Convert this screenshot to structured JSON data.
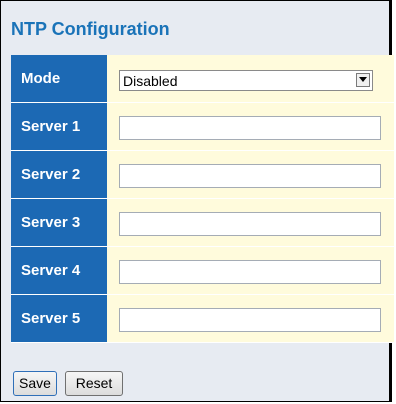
{
  "page": {
    "title": "NTP Configuration"
  },
  "form": {
    "mode": {
      "label": "Mode",
      "selected": "Disabled"
    },
    "servers": [
      {
        "label": "Server 1",
        "value": ""
      },
      {
        "label": "Server 2",
        "value": ""
      },
      {
        "label": "Server 3",
        "value": ""
      },
      {
        "label": "Server 4",
        "value": ""
      },
      {
        "label": "Server 5",
        "value": ""
      }
    ]
  },
  "buttons": {
    "save_label": "Save",
    "reset_label": "Reset"
  },
  "colors": {
    "title": "#1a73b8",
    "label_bg": "#1c69b4",
    "value_bg": "#fffbdc",
    "page_bg": "#e7ebf2"
  },
  "icons": {
    "select_arrow": "chevron-down-icon"
  }
}
